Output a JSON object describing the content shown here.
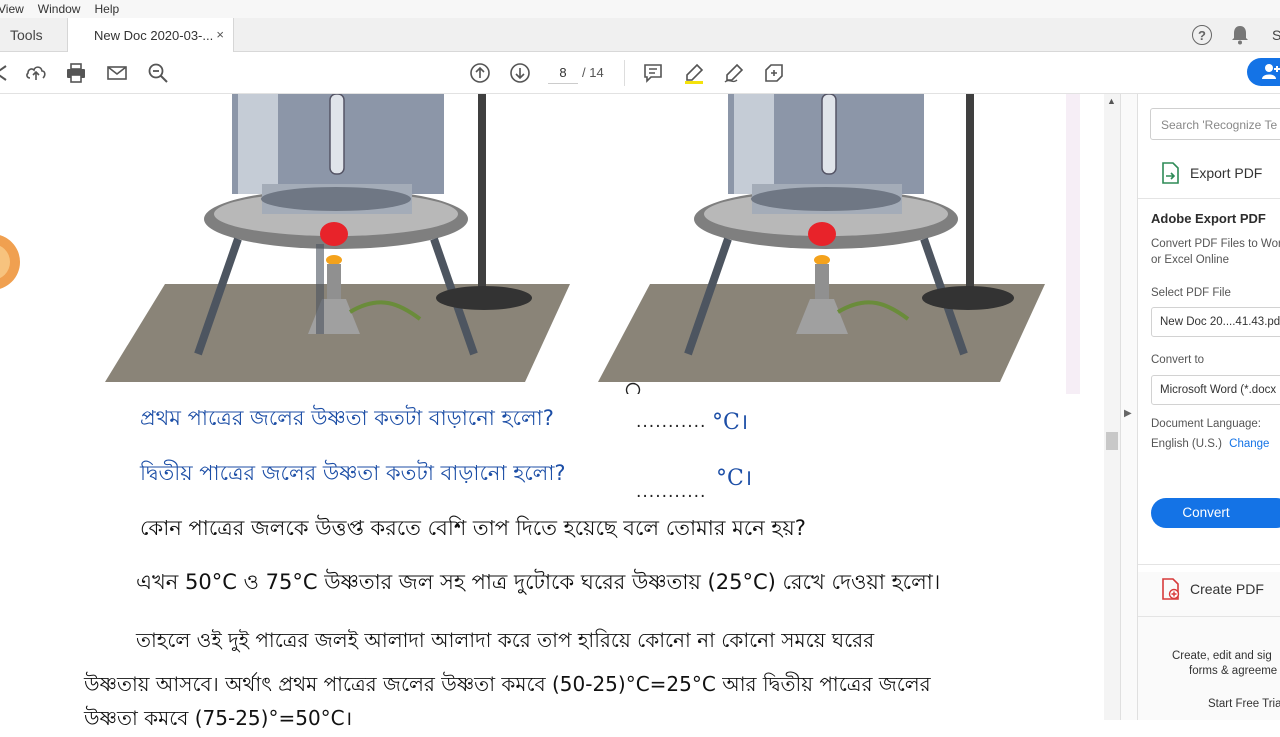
{
  "menu": [
    "View",
    "Window",
    "Help"
  ],
  "tabs": {
    "tools": "Tools",
    "document": "New Doc 2020-03-...",
    "close": "×"
  },
  "header_icons": {
    "help": "?",
    "user_initial": "S"
  },
  "toolbar": {
    "page_current": "8",
    "page_total": "/ 14"
  },
  "page": {
    "q1": "প্রথম পাত্রের জলের উষ্ণতা কতটা বাড়ানো হলো?",
    "q1_blank": "...........",
    "q1_unit": "°C।",
    "q2": "দ্বিতীয় পাত্রের জলের উষ্ণতা কতটা বাড়ানো হলো?",
    "q2_blank": "...........",
    "q2_unit": "°C।",
    "q3": "কোন পাত্রের জলকে উত্তপ্ত করতে বেশি তাপ দিতে হয়েছে বলে তোমার মনে হয়?",
    "p1": "এখন 50°C ও 75°C উষ্ণতার জল সহ পাত্র দুটোকে ঘরের উষ্ণতায় (25°C) রেখে দেওয়া হলো।",
    "p2": "তাহলে ওই দুই পাত্রের জলই আলাদা আলাদা করে তাপ হারিয়ে কোনো না কোনো সময়ে ঘরের",
    "p3": "উষ্ণতায় আসবে। অর্থাৎ প্রথম পাত্রের জলের উষ্ণতা কমবে (50-25)°C=25°C আর দ্বিতীয় পাত্রের জলের",
    "p4": "উষ্ণতা কমবে (75-25)°=50°C।"
  },
  "right_panel": {
    "search_placeholder": "Search 'Recognize Te",
    "export_pdf": "Export PDF",
    "heading": "Adobe Export PDF",
    "desc1": "Convert PDF Files to Wor",
    "desc2": "or Excel Online",
    "select_label": "Select PDF File",
    "selected_file": "New Doc 20....41.43.pd",
    "convert_to_label": "Convert to",
    "convert_to_value": "Microsoft Word (*.docx",
    "doc_lang_label": "Document Language:",
    "doc_lang_value": "English (U.S.)",
    "change_link": "Change",
    "convert_button": "Convert",
    "create_pdf": "Create PDF",
    "promo1": "Create, edit and sig",
    "promo2": "forms & agreeme",
    "trial_link": "Start Free Trial"
  },
  "colors": {
    "accent": "#1473e6",
    "bengali_blue": "#1c4ea6"
  },
  "icons": [
    "arrow-left-icon",
    "upload-icon",
    "print-icon",
    "mail-icon",
    "zoom-out-icon",
    "page-up-icon",
    "page-down-icon",
    "comment-icon",
    "highlight-icon",
    "sign-icon",
    "edit-tags-icon",
    "help-icon",
    "bell-icon",
    "file-export-icon",
    "file-create-icon",
    "share-user-icon"
  ]
}
